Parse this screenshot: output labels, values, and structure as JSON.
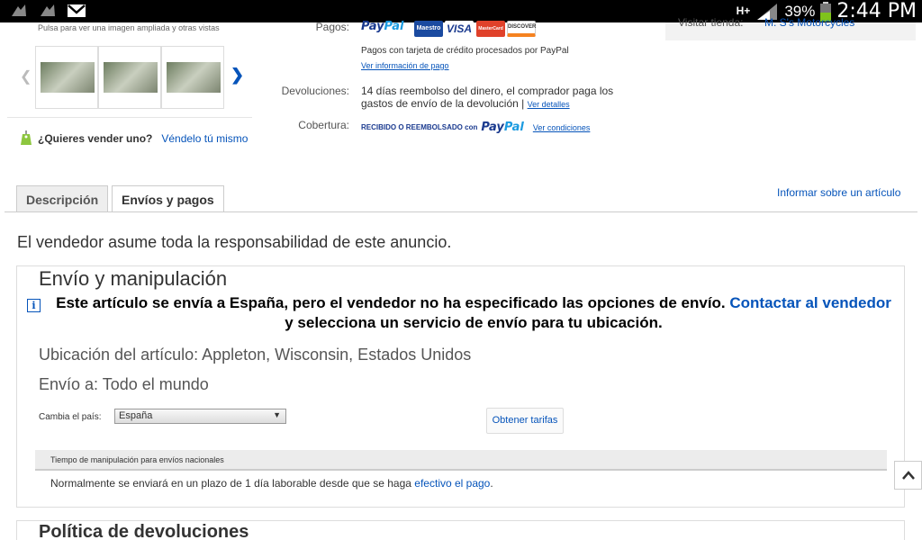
{
  "status_bar": {
    "network": "H+",
    "battery": "39%",
    "time": "2:44 PM"
  },
  "gallery": {
    "hint": "Pulsa para ver una imagen ampliada y otras vistas",
    "thumbnails": [
      "thumb-1",
      "thumb-2",
      "thumb-3"
    ]
  },
  "sell": {
    "question": "¿Quieres vender uno?",
    "link": "Véndelo tú mismo"
  },
  "payments": {
    "label": "Pagos:",
    "paypal_part1": "Pay",
    "paypal_part2": "Pal",
    "cards": [
      "Maestro",
      "VISA",
      "MasterCard",
      "DISCOVER"
    ],
    "card_colors": [
      "#1a4aa0",
      "#ffffff",
      "#e0412a",
      "#f58220"
    ],
    "note": "Pagos con tarjeta de crédito procesados por PayPal",
    "link": "Ver información de pago"
  },
  "returns": {
    "label": "Devoluciones:",
    "text": "14 días reembolso del dinero, el comprador paga los gastos de envío de la devolución |",
    "link": "Ver detalles"
  },
  "coverage": {
    "label": "Cobertura:",
    "text": "RECIBIDO O REEMBOLSADO con",
    "link": "Ver condiciones"
  },
  "store": {
    "text": "Visitar tienda:",
    "link": "M. S's Motorcycles"
  },
  "tabs": [
    {
      "label": "Descripción",
      "active": false
    },
    {
      "label": "Envíos y pagos",
      "active": true
    }
  ],
  "report_link": "Informar sobre un artículo",
  "responsibility": "El vendedor asume toda la responsabilidad de este anuncio.",
  "shipping": {
    "title": "Envío y manipulación",
    "notice_text": "Este artículo se envía a España, pero el vendedor no ha especificado las opciones de envío.",
    "notice_link": "Contactar al vendedor",
    "notice_text2": "y selecciona un servicio de envío para tu ubicación.",
    "location": "Ubicación del artículo: Appleton, Wisconsin, Estados Unidos",
    "ships_to": "Envío a: Todo el mundo",
    "country_label": "Cambia el país:",
    "country_value": "España",
    "rates_button": "Obtener tarifas",
    "handling_header": "Tiempo de manipulación para envíos nacionales",
    "handling_text": "Normalmente se enviará en un plazo de 1 día laborable desde que se haga",
    "handling_link": "efectivo el pago",
    "handling_end": "."
  },
  "returns_policy": {
    "title": "Política de devoluciones"
  }
}
